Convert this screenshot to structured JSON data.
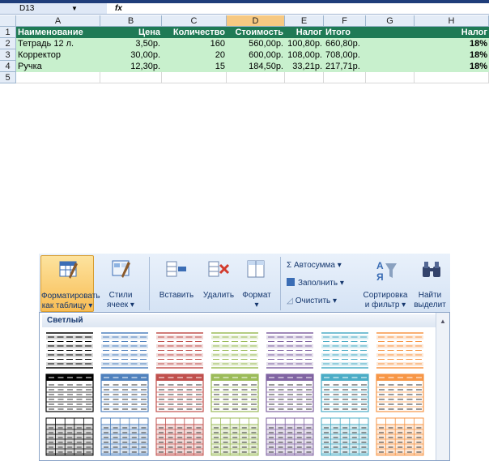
{
  "formula_bar": {
    "cell_ref": "D13",
    "dropdown_glyph": "▼",
    "fx": "fx"
  },
  "columns": [
    "A",
    "B",
    "C",
    "D",
    "E",
    "F",
    "G",
    "H"
  ],
  "rows": [
    "1",
    "2",
    "3",
    "4",
    "5"
  ],
  "table": {
    "headers": [
      "Наименование",
      "Цена",
      "Количество",
      "Стоимость",
      "Налог",
      "Итого",
      "",
      "Налог"
    ],
    "data": [
      [
        "Тетрадь 12 л.",
        "3,50р.",
        "160",
        "560,00р.",
        "100,80р.",
        "660,80р.",
        "",
        "18%"
      ],
      [
        "Корректор",
        "30,00р.",
        "20",
        "600,00р.",
        "108,00р.",
        "708,00р.",
        "",
        "18%"
      ],
      [
        "Ручка",
        "12,30р.",
        "15",
        "184,50р.",
        "33,21р.",
        "217,71р.",
        "",
        "18%"
      ]
    ]
  },
  "ribbon": {
    "format_table": "Форматировать\nкак таблицу ▾",
    "cell_styles": "Стили\nячеек ▾",
    "insert": "Вставить",
    "delete": "Удалить",
    "format": "Формат",
    "autosum": "Σ Автосумма ▾",
    "fill": "Заполнить ▾",
    "clear": "Очистить ▾",
    "sort_filter": "Сортировка\nи фильтр ▾",
    "find_select": "Найти\nвыделит"
  },
  "gallery": {
    "section": "Светлый",
    "colors": [
      "#000000",
      "#4f81bd",
      "#c0504d",
      "#9bbb59",
      "#8064a2",
      "#4bacc6",
      "#f79646"
    ],
    "light_tints": [
      "#d9d9d9",
      "#dbe5f1",
      "#f2dcdb",
      "#ebf1de",
      "#e5e0ec",
      "#dbeef3",
      "#fde9d9"
    ]
  }
}
